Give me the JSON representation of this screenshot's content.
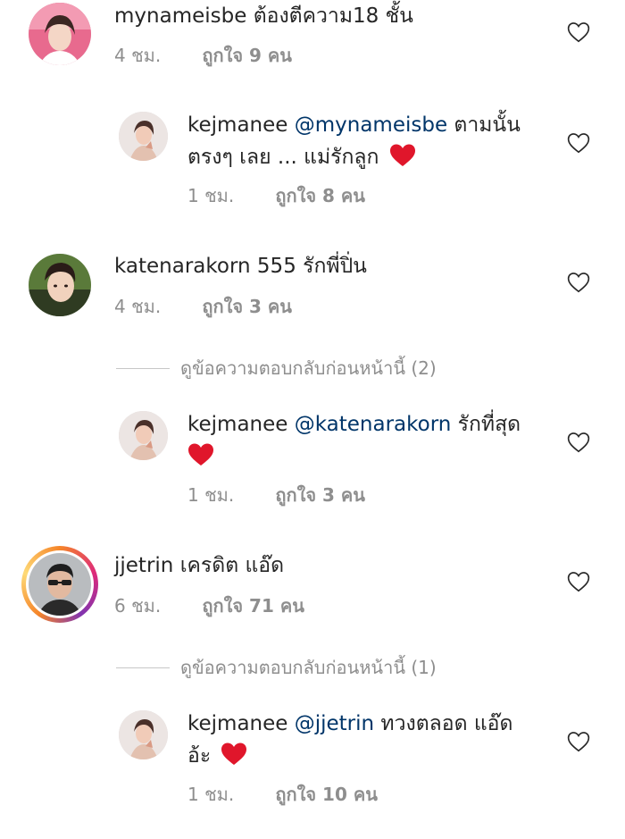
{
  "comments": [
    {
      "username": "mynameisbe",
      "text": "ต้องตีความ18 ชั้น",
      "time": "4 ชม.",
      "likes": "ถูกใจ 9 คน",
      "replies": [
        {
          "username": "kejmanee",
          "mention": "@mynameisbe",
          "text_line1": "ตามนั้น",
          "text_line2": "ตรงๆ เลย ... แม่รักลูก",
          "time": "1 ชม.",
          "likes": "ถูกใจ 8 คน"
        }
      ]
    },
    {
      "username": "katenarakorn",
      "text": "555 รักพี่ปิ่น",
      "time": "4 ชม.",
      "likes": "ถูกใจ 3 คน",
      "view_previous_replies": "ดูข้อความตอบกลับก่อนหน้านี้ (2)",
      "replies": [
        {
          "username": "kejmanee",
          "mention": "@katenarakorn",
          "text_line1": "รักที่สุด",
          "text_line2": "",
          "time": "1 ชม.",
          "likes": "ถูกใจ 3 คน"
        }
      ]
    },
    {
      "username": "jjetrin",
      "text": "เครดิต แอ๊ด",
      "time": "6 ชม.",
      "likes": "ถูกใจ 71 คน",
      "view_previous_replies": "ดูข้อความตอบกลับก่อนหน้านี้ (1)",
      "replies": [
        {
          "username": "kejmanee",
          "mention": "@jjetrin",
          "text_line1": "ทวงตลอด แอ๊ด",
          "text_line2": "อ้ะ",
          "time": "1 ชม.",
          "likes": "ถูกใจ 10 คน"
        }
      ]
    }
  ],
  "colors": {
    "text": "#262626",
    "meta": "#8e8e8e",
    "mention": "#003569",
    "heart_emoji": "#e0162b"
  },
  "icons": {
    "like": "heart-outline-icon",
    "emoji": "red-heart-icon"
  }
}
